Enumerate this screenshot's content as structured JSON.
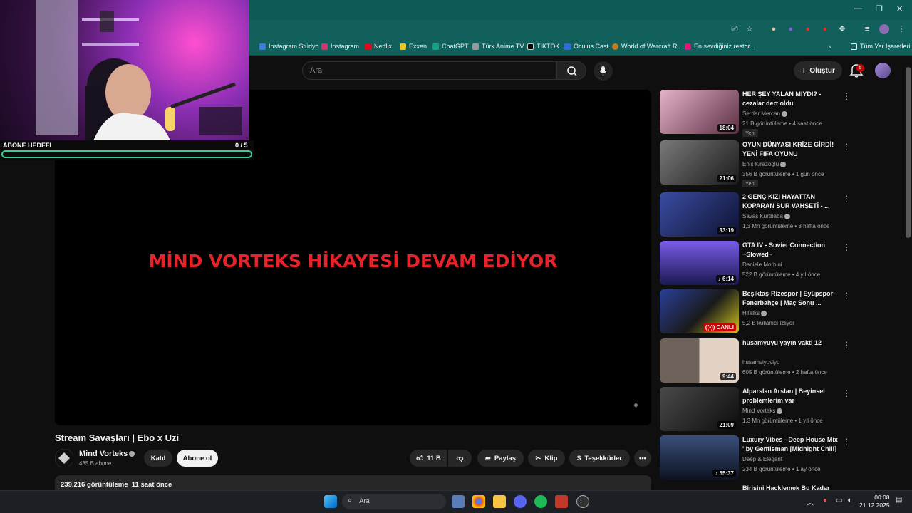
{
  "browser": {
    "bookmarks": [
      {
        "label": "Instagram Stüdyo",
        "color": "#3d7bd9"
      },
      {
        "label": "Instagram",
        "color": "#d6336c"
      },
      {
        "label": "Netflix",
        "color": "#e50914"
      },
      {
        "label": "Exxen",
        "color": "#f0c419"
      },
      {
        "label": "ChatGPT",
        "color": "#10a37f"
      },
      {
        "label": "Türk Anime TV",
        "color": "#999999"
      },
      {
        "label": "TİKTOK",
        "color": "#000000"
      },
      {
        "label": "Oculus Cast",
        "color": "#2b6de0"
      },
      {
        "label": "World of Warcraft R...",
        "color": "#c57a1b"
      },
      {
        "label": "En sevdiğiniz restor...",
        "color": "#e2137a"
      }
    ],
    "all_bookmarks": "Tüm Yer İşaretleri",
    "overflow": "»"
  },
  "header": {
    "search_placeholder": "Ara",
    "create_label": "Oluştur",
    "notif_count": "5"
  },
  "webcam": {
    "goal_label": "ABONE HEDEFI",
    "goal_count": "0 / 5"
  },
  "player": {
    "overlay_text": "MİND VORTEKS HİKAYESİ DEVAM EDİYOR"
  },
  "video": {
    "title": "Stream Savaşları | Ebo x Uzi",
    "channel": "Mind Vorteks",
    "subscribers": "485 B abone",
    "join_label": "Katıl",
    "subscribe_label": "Abone ol",
    "likes": "11 B",
    "share_label": "Paylaş",
    "clip_label": "Klip",
    "thanks_label": "Teşekkürler",
    "views_line": "239.216 görüntüleme  11 saat önce"
  },
  "recommendations": [
    {
      "title": "HER ŞEY YALAN MIYDI? - cezalar dert oldu",
      "channel": "Serdar Mercan",
      "meta": "21 B görüntüleme • 4 saat önce",
      "badge": "Yeni",
      "duration": "18:04",
      "color1": "#d9a9c2",
      "color2": "#6b3b4f"
    },
    {
      "title": "OYUN DÜNYASI KRİZE GİRDİ! YENİ FIFA OYUNU DUYURULD...",
      "channel": "Enis Kirazoglu",
      "meta": "356 B görüntüleme • 1 gün önce",
      "badge": "Yeni",
      "duration": "21:06",
      "color1": "#6e6e6e",
      "color2": "#1d1d1d"
    },
    {
      "title": "2 GENÇ KIZI HAYATTAN KOPARAN SUR VAHŞETİ - ...",
      "channel": "Savaş Kurtbaba",
      "meta": "1,3 Mn görüntüleme • 3 hafta önce",
      "badge": "",
      "duration": "33:19",
      "color1": "#2b3b8a",
      "color2": "#0e1233"
    },
    {
      "title": "GTA IV - Soviet Connection ~Slowed~",
      "channel": "Daniele Morbini",
      "meta": "522 B görüntüleme • 4 yıl önce",
      "badge": "",
      "duration": "♪ 6:14",
      "color1": "#6a4fd6",
      "color2": "#1a1950"
    },
    {
      "title": "Beşiktaş-Rizespor | Eyüpspor-Fenerbahçe | Maç Sonu ...",
      "channel": "HTalks",
      "meta": "5,2 B kullanıcı izliyor",
      "badge": "",
      "duration": "((•)) CANLI",
      "color1": "#2a3f9a",
      "color2": "#d1c41e"
    },
    {
      "title": "husamyuyu yayın vakti 12",
      "channel": "husamviyuviyu",
      "meta": "605 B görüntüleme • 2 hafta önce",
      "badge": "",
      "duration": "9:44",
      "color1": "#8a7a70",
      "color2": "#e3d2c4"
    },
    {
      "title": "Alparslan Arslan | Beyinsel problemlerim var",
      "channel": "Mind Vorteks",
      "meta": "1,3 Mn görüntüleme • 1 yıl önce",
      "badge": "",
      "duration": "21:09",
      "color1": "#3a3a3a",
      "color2": "#0c0c0c"
    },
    {
      "title": "Luxury Vibes - Deep House Mix ' by Gentleman [Midnight Chill] ...",
      "channel": "Deep & Elegant",
      "meta": "234 B görüntüleme • 1 ay önce",
      "badge": "",
      "duration": "♪ 55:37",
      "color1": "#3a4f7a",
      "color2": "#0d1322"
    }
  ],
  "next_partial_title": "Birisini Hacklemek Bu Kadar",
  "taskbar": {
    "search": "Ara",
    "time": "00:08",
    "date": "21.12.2025"
  }
}
